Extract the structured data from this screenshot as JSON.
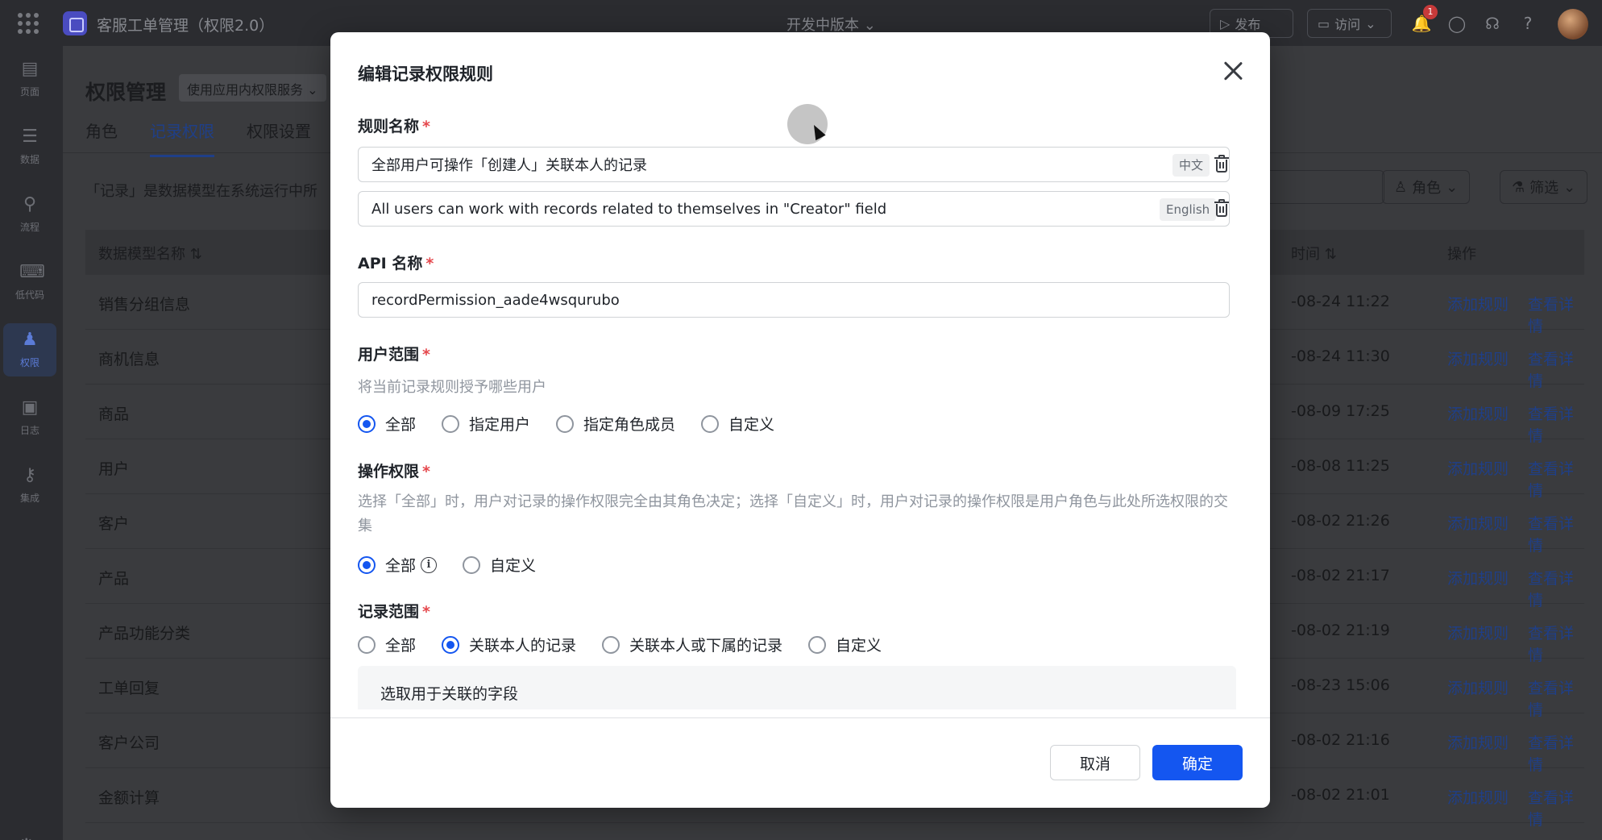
{
  "app": {
    "title": "客服工单管理（权限2.0）",
    "version_label": "开发中版本",
    "publish_label": "发布",
    "visit_label": "访问",
    "notification_count": "1"
  },
  "rail": {
    "items": [
      {
        "label": "页面",
        "icon": "pages-icon"
      },
      {
        "label": "数据",
        "icon": "database-icon"
      },
      {
        "label": "流程",
        "icon": "flow-icon"
      },
      {
        "label": "低代码",
        "icon": "code-icon"
      },
      {
        "label": "权限",
        "icon": "permission-icon",
        "active": true
      },
      {
        "label": "日志",
        "icon": "log-icon"
      },
      {
        "label": "集成",
        "icon": "integration-icon"
      }
    ]
  },
  "page": {
    "title": "权限管理",
    "service_select": "使用应用内权限服务",
    "tabs": [
      "角色",
      "记录权限",
      "权限设置"
    ],
    "active_tab": 1,
    "description": "「记录」是数据模型在系统运行中所",
    "role_filter": "角色",
    "filter_label": "筛选",
    "table": {
      "col_name": "数据模型名称",
      "col_time": "时间",
      "col_actions": "操作",
      "add_rule_label": "添加规则",
      "view_detail_label": "查看详情",
      "rows": [
        {
          "name": "销售分组信息",
          "time": "-08-24 11:22"
        },
        {
          "name": "商机信息",
          "time": "-08-24 11:30"
        },
        {
          "name": "商品",
          "time": "-08-09 17:25"
        },
        {
          "name": "用户",
          "time": "-08-08 11:25"
        },
        {
          "name": "客户",
          "time": "-08-02 21:26"
        },
        {
          "name": "产品",
          "time": "-08-02 21:17"
        },
        {
          "name": "产品功能分类",
          "time": "-08-02 21:19"
        },
        {
          "name": "工单回复",
          "time": "-08-23 15:06"
        },
        {
          "name": "客户公司",
          "time": "-08-02 21:16"
        },
        {
          "name": "金额计算",
          "time": "-08-02 21:01"
        }
      ]
    }
  },
  "modal": {
    "title": "编辑记录权限规则",
    "rule_name": {
      "label": "规则名称",
      "zh_value": "全部用户可操作「创建人」关联本人的记录",
      "zh_tag": "中文",
      "en_value": "All users can work with records related to themselves in \"Creator\" field",
      "en_tag": "English"
    },
    "api_name": {
      "label": "API 名称",
      "value": "recordPermission_aade4wsqurubo"
    },
    "user_scope": {
      "label": "用户范围",
      "hint": "将当前记录规则授予哪些用户",
      "options": [
        "全部",
        "指定用户",
        "指定角色成员",
        "自定义"
      ],
      "selected": 0
    },
    "op_permission": {
      "label": "操作权限",
      "hint": "选择「全部」时，用户对记录的操作权限完全由其角色决定；选择「自定义」时，用户对记录的操作权限是用户角色与此处所选权限的交集",
      "options": [
        "全部",
        "自定义"
      ],
      "selected": 0
    },
    "record_scope": {
      "label": "记录范围",
      "options": [
        "全部",
        "关联本人的记录",
        "关联本人或下属的记录",
        "自定义"
      ],
      "selected": 1
    },
    "assoc_field_label": "选取用于关联的字段",
    "cancel_label": "取消",
    "ok_label": "确定"
  },
  "colors": {
    "primary": "#1456f0",
    "required": "#e5484d",
    "hint": "#8f959e"
  }
}
